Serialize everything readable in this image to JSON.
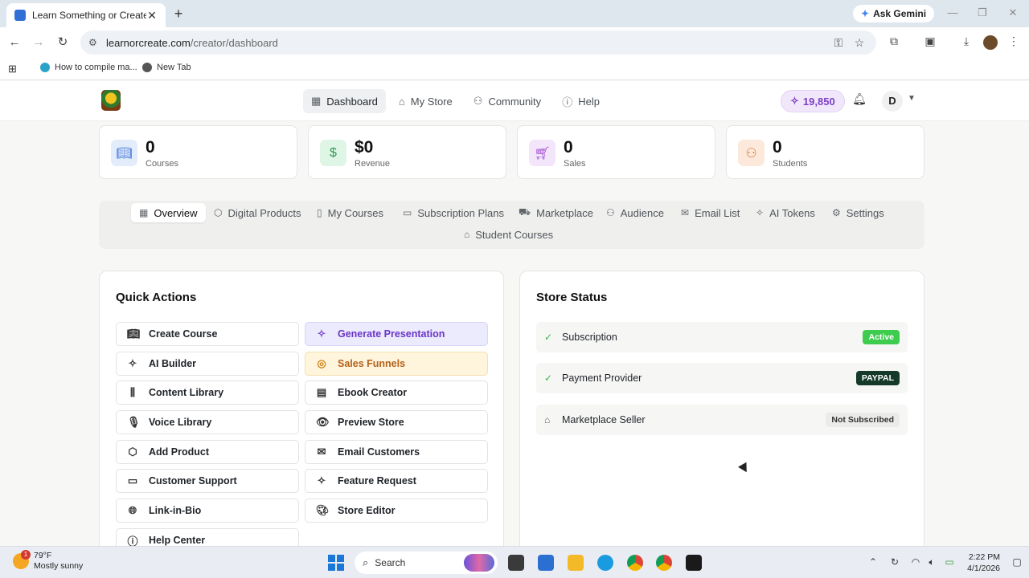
{
  "browser": {
    "tab_title": "Learn Something or Create Something",
    "new_tab_symbol": "+",
    "ask_gemini": "Ask Gemini",
    "url_host": "learnorcreate.com",
    "url_path": "/creator/dashboard",
    "bookmarks": [
      {
        "label": "How to compile ma...",
        "color": "#2aa3c9"
      },
      {
        "label": "New Tab",
        "color": "#555555"
      }
    ]
  },
  "header": {
    "nav": [
      {
        "label": "Dashboard",
        "icon": "grid-icon",
        "active": true
      },
      {
        "label": "My Store",
        "icon": "store-icon",
        "active": false
      },
      {
        "label": "Community",
        "icon": "users-icon",
        "active": false
      },
      {
        "label": "Help",
        "icon": "help-circle-icon",
        "active": false
      }
    ],
    "tokens": "19,850",
    "avatar_initial": "D"
  },
  "stats": [
    {
      "value": "0",
      "label": "Courses",
      "icon": "book-icon",
      "bg": "#e3ecfb",
      "fg": "#3a6fd8"
    },
    {
      "value": "$0",
      "label": "Revenue",
      "icon": "dollar-icon",
      "bg": "#dff5e6",
      "fg": "#2e9e56"
    },
    {
      "value": "0",
      "label": "Sales",
      "icon": "cart-icon",
      "bg": "#f3e6fb",
      "fg": "#a04ad0"
    },
    {
      "value": "0",
      "label": "Students",
      "icon": "users-icon",
      "bg": "#fde9db",
      "fg": "#e07a35"
    }
  ],
  "tabs": [
    {
      "label": "Overview",
      "active": true
    },
    {
      "label": "Digital Products"
    },
    {
      "label": "My Courses"
    },
    {
      "label": "Subscription Plans"
    },
    {
      "label": "Marketplace"
    },
    {
      "label": "Audience"
    },
    {
      "label": "Email List"
    },
    {
      "label": "AI Tokens"
    },
    {
      "label": "Settings"
    },
    {
      "label": "Student Courses"
    }
  ],
  "quick_actions": {
    "title": "Quick Actions",
    "left": [
      "Create Course",
      "AI Builder",
      "Content Library",
      "Voice Library",
      "Add Product",
      "Customer Support",
      "Link-in-Bio",
      "Help Center"
    ],
    "right": [
      "Generate Presentation",
      "Sales Funnels",
      "Ebook Creator",
      "Preview Store",
      "Email Customers",
      "Feature Request",
      "Store Editor"
    ]
  },
  "store_status": {
    "title": "Store Status",
    "rows": [
      {
        "label": "Subscription",
        "badge": "Active"
      },
      {
        "label": "Payment Provider",
        "badge": "PAYPAL"
      },
      {
        "label": "Marketplace Seller",
        "badge": "Not Subscribed"
      }
    ]
  },
  "taskbar": {
    "temp": "79°F",
    "weather": "Mostly sunny",
    "weather_badge": "1",
    "search": "Search",
    "time": "2:22 PM",
    "date": "4/1/2026"
  }
}
